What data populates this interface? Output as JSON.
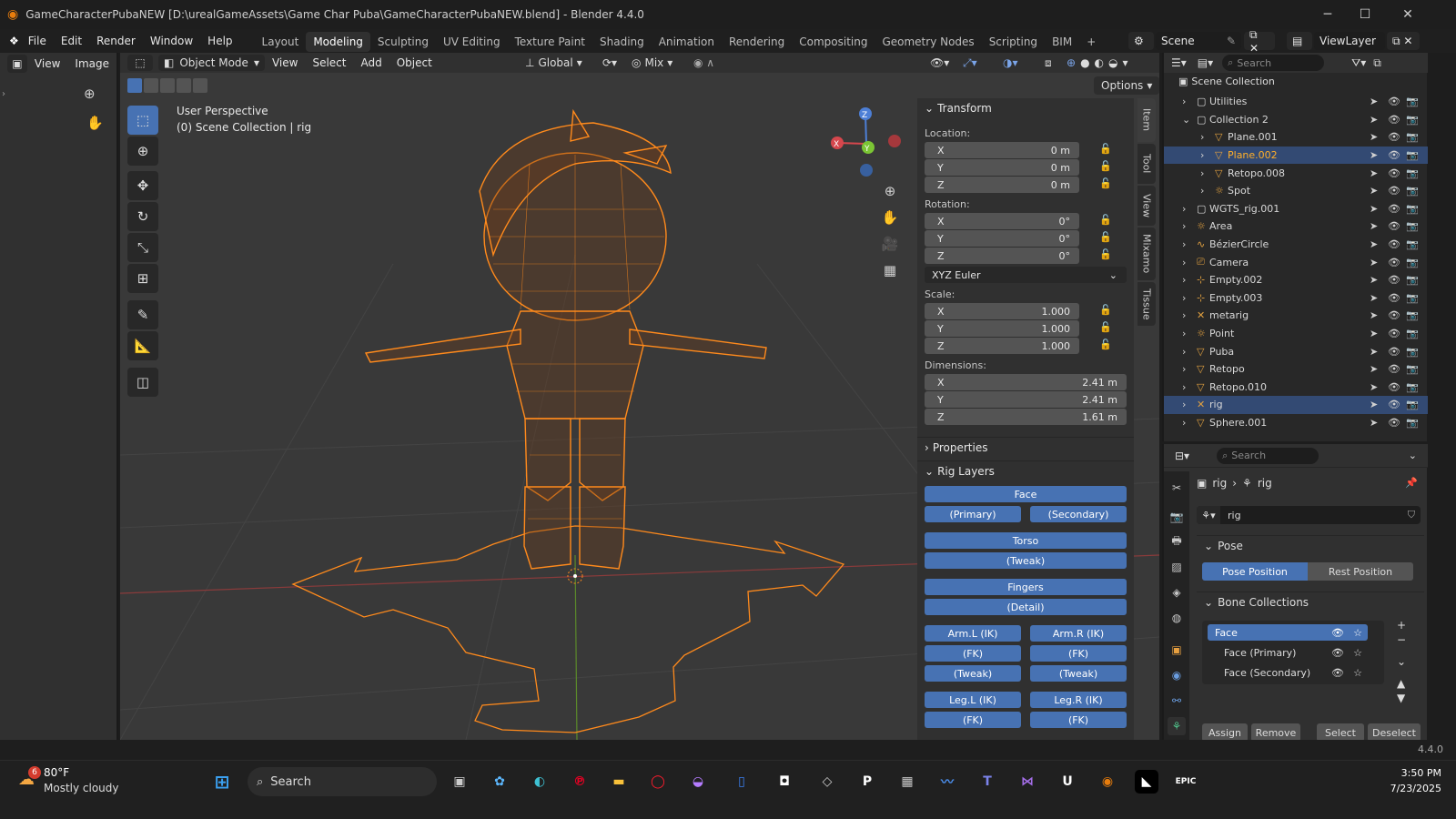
{
  "window": {
    "title": "GameCharacterPubaNEW [D:\\urealGameAssets\\Game Char Puba\\GameCharacterPubaNEW.blend] - Blender 4.4.0"
  },
  "menu": {
    "items": [
      "File",
      "Edit",
      "Render",
      "Window",
      "Help"
    ]
  },
  "workspaces": {
    "tabs": [
      "Layout",
      "Modeling",
      "Sculpting",
      "UV Editing",
      "Texture Paint",
      "Shading",
      "Animation",
      "Rendering",
      "Compositing",
      "Geometry Nodes",
      "Scripting",
      "BIM"
    ],
    "active": "Modeling"
  },
  "scene": {
    "name": "Scene",
    "view_layer": "ViewLayer"
  },
  "image_editor": {
    "menu": [
      "View",
      "Image"
    ]
  },
  "viewport": {
    "mode": "Object Mode",
    "menu": [
      "View",
      "Select",
      "Add",
      "Object"
    ],
    "orientation": "Global",
    "snap_mode": "Mix",
    "options_label": "Options",
    "overlay_title": "User Perspective",
    "overlay_subtitle": "(0) Scene Collection | rig"
  },
  "npanel": {
    "transform_header": "Transform",
    "location_label": "Location:",
    "location": [
      {
        "axis": "X",
        "value": "0 m"
      },
      {
        "axis": "Y",
        "value": "0 m"
      },
      {
        "axis": "Z",
        "value": "0 m"
      }
    ],
    "rotation_label": "Rotation:",
    "rotation": [
      {
        "axis": "X",
        "value": "0°"
      },
      {
        "axis": "Y",
        "value": "0°"
      },
      {
        "axis": "Z",
        "value": "0°"
      }
    ],
    "rotation_mode": "XYZ Euler",
    "scale_label": "Scale:",
    "scale": [
      {
        "axis": "X",
        "value": "1.000"
      },
      {
        "axis": "Y",
        "value": "1.000"
      },
      {
        "axis": "Z",
        "value": "1.000"
      }
    ],
    "dimensions_label": "Dimensions:",
    "dimensions": [
      {
        "axis": "X",
        "value": "2.41 m"
      },
      {
        "axis": "Y",
        "value": "2.41 m"
      },
      {
        "axis": "Z",
        "value": "1.61 m"
      }
    ],
    "properties_header": "Properties",
    "rig_layers_header": "Rig Layers",
    "rig": {
      "face": "Face",
      "primary": "(Primary)",
      "secondary": "(Secondary)",
      "torso": "Torso",
      "tweak": "(Tweak)",
      "fingers": "Fingers",
      "detail": "(Detail)",
      "arm_l_ik": "Arm.L (IK)",
      "arm_r_ik": "Arm.R (IK)",
      "fk": "(FK)",
      "leg_l_ik": "Leg.L (IK)",
      "leg_r_ik": "Leg.R (IK)"
    },
    "tabs": [
      "Item",
      "Tool",
      "View",
      "Mixamo",
      "Tissue"
    ]
  },
  "outliner": {
    "search_placeholder": "Search",
    "root": "Scene Collection",
    "items": [
      {
        "name": "Utilities",
        "icon": "collection-icon"
      },
      {
        "name": "Collection 2",
        "icon": "collection-icon"
      },
      {
        "name": "Plane.001",
        "icon": "mesh-icon"
      },
      {
        "name": "Plane.002",
        "icon": "mesh-icon",
        "active": true
      },
      {
        "name": "Retopo.008",
        "icon": "mesh-icon"
      },
      {
        "name": "Spot",
        "icon": "light-icon"
      },
      {
        "name": "WGTS_rig.001",
        "icon": "collection-icon"
      },
      {
        "name": "Area",
        "icon": "light-icon"
      },
      {
        "name": "BézierCircle",
        "icon": "curve-icon"
      },
      {
        "name": "Camera",
        "icon": "camera-icon"
      },
      {
        "name": "Empty.002",
        "icon": "empty-icon"
      },
      {
        "name": "Empty.003",
        "icon": "empty-icon"
      },
      {
        "name": "metarig",
        "icon": "armature-icon"
      },
      {
        "name": "Point",
        "icon": "light-icon"
      },
      {
        "name": "Puba",
        "icon": "mesh-icon"
      },
      {
        "name": "Retopo",
        "icon": "mesh-icon"
      },
      {
        "name": "Retopo.010",
        "icon": "mesh-icon"
      },
      {
        "name": "rig",
        "icon": "armature-icon",
        "selected": true
      },
      {
        "name": "Sphere.001",
        "icon": "mesh-icon"
      }
    ]
  },
  "properties": {
    "search_placeholder": "Search",
    "breadcrumb": [
      "rig",
      "rig"
    ],
    "data_name": "rig",
    "pose_header": "Pose",
    "pose_position": "Pose Position",
    "rest_position": "Rest Position",
    "bone_collections_header": "Bone Collections",
    "bone_collections": [
      "Face",
      "Face (Primary)",
      "Face (Secondary)"
    ],
    "buttons": [
      "Assign",
      "Remove",
      "Select",
      "Deselect"
    ]
  },
  "statusbar": {
    "version": "4.4.0"
  },
  "taskbar": {
    "weather_temp": "80°F",
    "weather_desc": "Mostly cloudy",
    "weather_badge": "6",
    "search": "Search",
    "time": "3:50 PM",
    "date": "7/23/2025"
  },
  "colors": {
    "accent": "#4772b3",
    "selection_orange": "#ff8a1c",
    "viewport_bg": "#393939",
    "panel_bg": "#303030"
  }
}
